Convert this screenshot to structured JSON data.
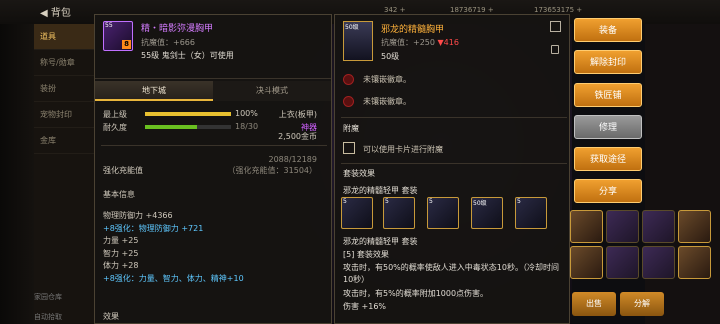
{
  "topbar": {
    "back_label": "背包",
    "currency_1": "342 +",
    "currency_2": "18736719 +",
    "currency_3": "173653175 +"
  },
  "sidebar": {
    "items": [
      "道具",
      "称号/勋章",
      "装扮",
      "宠物封印",
      "金库"
    ],
    "bottom_items": [
      "家园仓库",
      "自动拾取"
    ]
  },
  "item": {
    "name": "精・暗影弥漫胸甲",
    "attack_resist": "抗魔值：+666",
    "requirement": "55级 鬼剑士（女）可使用",
    "tabs": [
      "地下城",
      "决斗模式"
    ],
    "grade_label": "最上级",
    "grade_pct": "100%",
    "durability_label": "耐久度",
    "durability": "18/30",
    "durability_fraction": 0.6,
    "slot_type": "上衣(板甲)",
    "rarity": "神器",
    "price": "2,500金币",
    "enhance_label": "强化充能值",
    "enhance_value": "2088/12189",
    "enhance_sub": "（强化充能值：31504）",
    "basic_title": "基本信息",
    "stats": [
      {
        "text": "物理防御力 +4366",
        "style": "normal"
      },
      {
        "text": "+8强化：物理防御力 +721",
        "style": "hl"
      },
      {
        "text": "力量 +25",
        "style": "normal"
      },
      {
        "text": "智力 +25",
        "style": "normal"
      },
      {
        "text": "体力 +28",
        "style": "normal"
      },
      {
        "text": "+8强化：力量、智力、体力、精神+10",
        "style": "hl"
      }
    ],
    "effect_title": "效果"
  },
  "compare": {
    "level_badge": "50级",
    "name": "邪龙的精髓胸甲",
    "attack_resist": "抗魔值：+250",
    "diff": "▼416",
    "level": "50级",
    "sockets": [
      "未镶嵌徽章。",
      "未镶嵌徽章。"
    ],
    "enchant_title": "附魔",
    "enchant_text": "可以使用卡片进行附魔",
    "set_title": "套装效果",
    "set_subtitle": "邪龙的精髓轻甲 套装",
    "set_icon_labels": [
      "5",
      "5",
      "5",
      "50级",
      "5"
    ],
    "set_name": "邪龙的精髓轻甲 套装",
    "set_bonus_title": "[5] 套装效果",
    "set_desc": "攻击时，有50%的概率使敌人进入中毒状态10秒。（冷却时间10秒）",
    "set_desc2": "攻击时，有5%的概率附加1000点伤害。",
    "set_desc3": "伤害 +16%"
  },
  "actions": [
    "装备",
    "解除封印",
    "铁匠铺",
    "修理",
    "获取途径",
    "分享"
  ],
  "bottom_actions": [
    "出售",
    "分解"
  ]
}
